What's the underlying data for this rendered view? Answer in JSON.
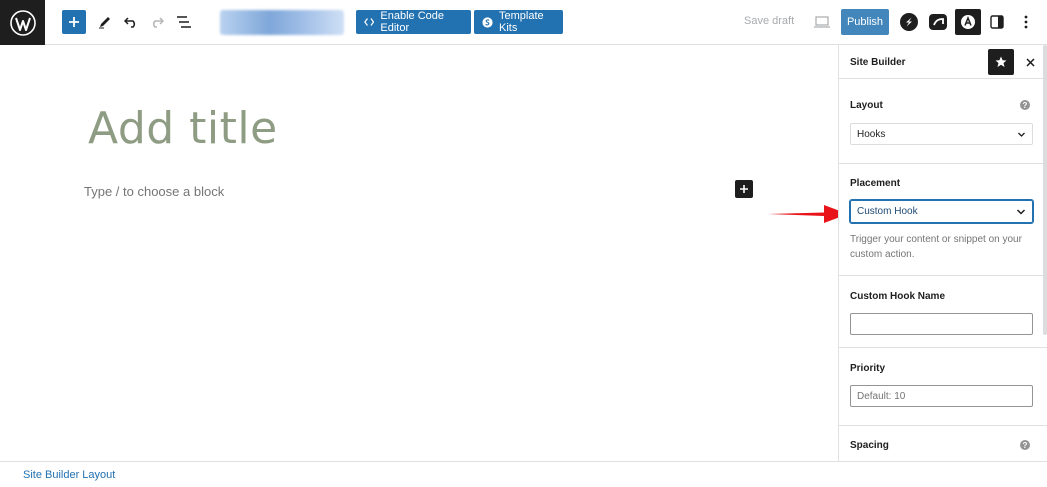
{
  "toolbar": {
    "enable_code_editor_label": "Enable Code Editor",
    "template_kits_label": "Template Kits",
    "save_draft_label": "Save draft",
    "publish_label": "Publish"
  },
  "editor": {
    "title_placeholder": "Add title",
    "block_placeholder": "Type / to choose a block"
  },
  "sidebar": {
    "title": "Site Builder",
    "layout": {
      "label": "Layout",
      "value": "Hooks"
    },
    "placement": {
      "label": "Placement",
      "value": "Custom Hook",
      "help": "Trigger your content or snippet on your custom action."
    },
    "custom_hook_name": {
      "label": "Custom Hook Name",
      "value": ""
    },
    "priority": {
      "label": "Priority",
      "placeholder": "Default: 10"
    },
    "spacing": {
      "label": "Spacing"
    }
  },
  "footer": {
    "breadcrumb": "Site Builder Layout"
  },
  "colors": {
    "accent": "#2271b1",
    "dark": "#1e1e1e",
    "arrow": "#e8141a"
  }
}
